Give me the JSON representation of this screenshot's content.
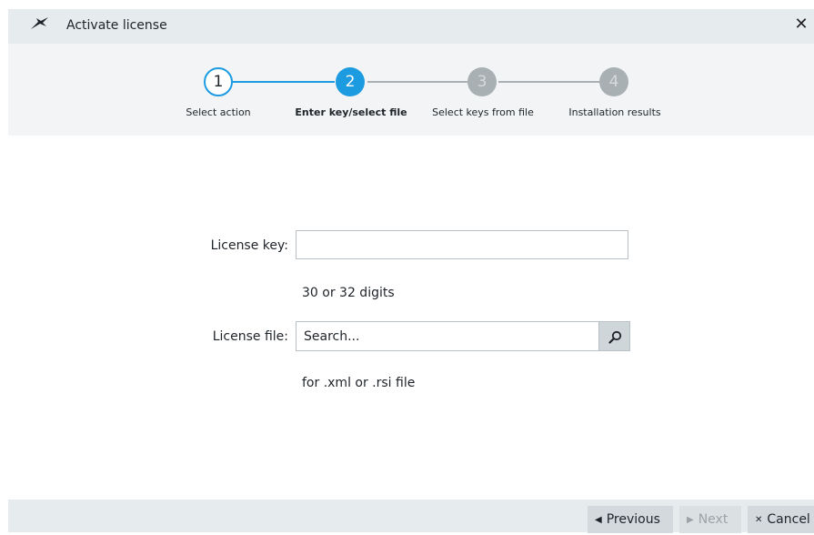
{
  "window": {
    "title": "Activate license",
    "close_glyph": "✕",
    "icon": "app-logo-icon"
  },
  "wizard": {
    "current_step": 2,
    "steps": [
      {
        "number": "1",
        "label": "Select action",
        "state": "completed"
      },
      {
        "number": "2",
        "label": "Enter key/select file",
        "state": "active"
      },
      {
        "number": "3",
        "label": "Select keys from file",
        "state": "pending"
      },
      {
        "number": "4",
        "label": "Installation results",
        "state": "pending"
      }
    ]
  },
  "form": {
    "license_key": {
      "label": "License key:",
      "value": "",
      "hint": "30 or 32 digits"
    },
    "license_file": {
      "label": "License file:",
      "placeholder": "Search...",
      "value": "",
      "hint": "for .xml or .rsi file",
      "search_icon": "magnifier-icon"
    }
  },
  "footer": {
    "previous_glyph": "◀",
    "previous_label": "Previous",
    "next_glyph": "▶",
    "next_label": "Next",
    "next_enabled": false,
    "cancel_glyph": "✕",
    "cancel_label": "Cancel"
  },
  "colors": {
    "accent": "#1d9be0",
    "inactive_step": "#a8b0b4",
    "title_bar": "#e6ebee",
    "wizard_band": "#f2f4f5"
  }
}
